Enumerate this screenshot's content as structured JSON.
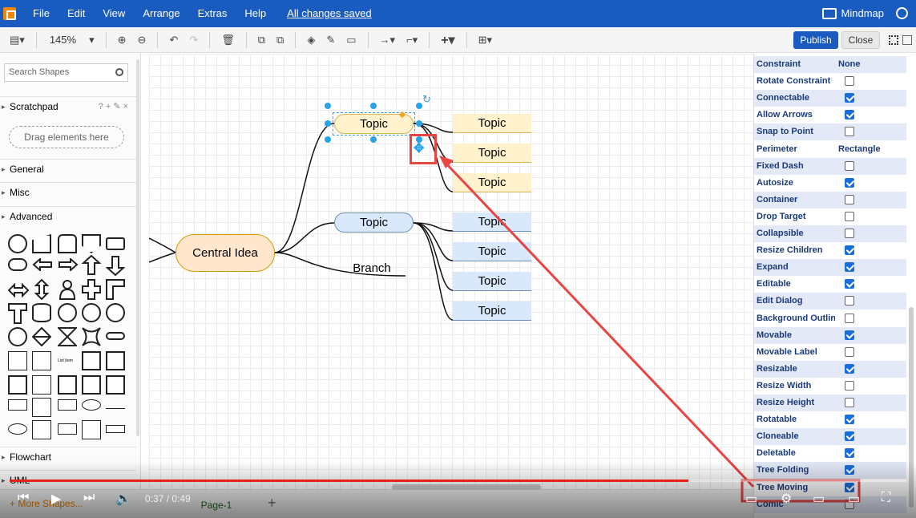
{
  "menubar": {
    "items": [
      "File",
      "Edit",
      "View",
      "Arrange",
      "Extras",
      "Help"
    ],
    "saved": "All changes saved",
    "doc_name": "Mindmap"
  },
  "toolbar": {
    "zoom": "145%",
    "publish": "Publish",
    "close": "Close"
  },
  "sidebar": {
    "search_placeholder": "Search Shapes",
    "scratchpad": "Scratchpad",
    "scratchpad_tools": "? + ✎ ×",
    "drag_here": "Drag elements here",
    "sections": [
      "General",
      "Misc",
      "Advanced",
      "Flowchart",
      "UML"
    ],
    "more_shapes": "+ More Shapes..."
  },
  "canvas": {
    "central": "Central Idea",
    "topic_main_1": "Topic",
    "topic_main_2": "Topic",
    "branch": "Branch",
    "subtopics_yellow": [
      "Topic",
      "Topic",
      "Topic"
    ],
    "subtopics_blue": [
      "Topic",
      "Topic",
      "Topic",
      "Topic"
    ]
  },
  "panel": {
    "props": [
      {
        "label": "Constraint",
        "value": "None"
      },
      {
        "label": "Rotate Constraint",
        "checked": false
      },
      {
        "label": "Connectable",
        "checked": true
      },
      {
        "label": "Allow Arrows",
        "checked": true
      },
      {
        "label": "Snap to Point",
        "checked": false
      },
      {
        "label": "Perimeter",
        "value": "Rectangle"
      },
      {
        "label": "Fixed Dash",
        "checked": false
      },
      {
        "label": "Autosize",
        "checked": true
      },
      {
        "label": "Container",
        "checked": false
      },
      {
        "label": "Drop Target",
        "checked": false
      },
      {
        "label": "Collapsible",
        "checked": false
      },
      {
        "label": "Resize Children",
        "checked": true
      },
      {
        "label": "Expand",
        "checked": true
      },
      {
        "label": "Editable",
        "checked": true
      },
      {
        "label": "Edit Dialog",
        "checked": false
      },
      {
        "label": "Background Outline",
        "checked": false
      },
      {
        "label": "Movable",
        "checked": true
      },
      {
        "label": "Movable Label",
        "checked": false
      },
      {
        "label": "Resizable",
        "checked": true
      },
      {
        "label": "Resize Width",
        "checked": false
      },
      {
        "label": "Resize Height",
        "checked": false
      },
      {
        "label": "Rotatable",
        "checked": true
      },
      {
        "label": "Cloneable",
        "checked": true
      },
      {
        "label": "Deletable",
        "checked": true
      },
      {
        "label": "Tree Folding",
        "checked": true
      },
      {
        "label": "Tree Moving",
        "checked": true
      },
      {
        "label": "Comic",
        "checked": false
      }
    ]
  },
  "tabbar": {
    "page": "Page-1"
  },
  "video": {
    "time": "0:37 / 0:49",
    "progress": 0.757
  },
  "colors": {
    "brand": "#1a5bbf",
    "highlight": "#e84545",
    "yellow_node": "#fff2cc",
    "blue_node": "#dae8fc",
    "central_node": "#ffe6cc"
  }
}
